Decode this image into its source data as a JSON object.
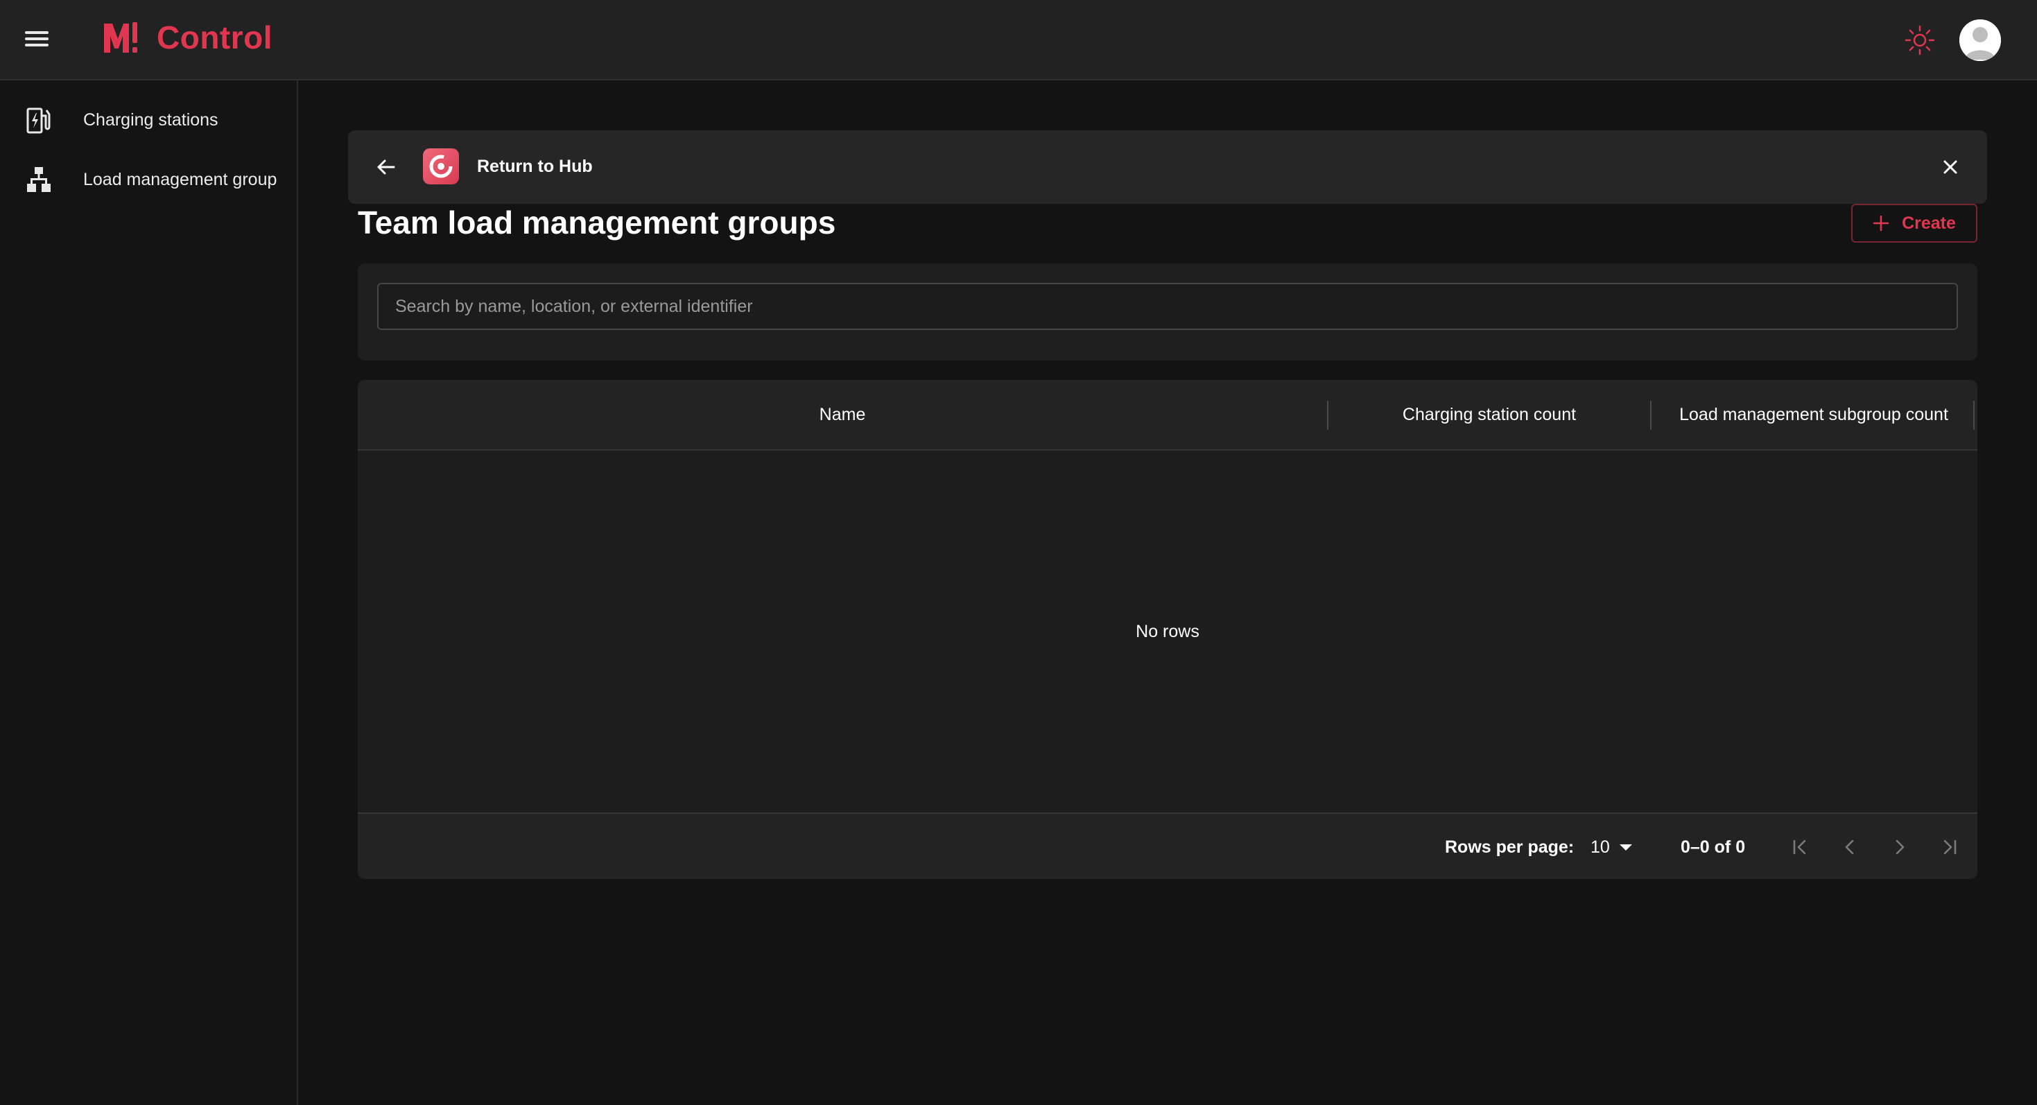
{
  "app": {
    "brand_mark": "M!",
    "brand_name": "Control",
    "accent_color": "#e0364f"
  },
  "topbar": {
    "menu_icon": "hamburger-menu-icon",
    "theme_icon": "sun-icon",
    "avatar_icon": "user-avatar-icon"
  },
  "sidebar": {
    "items": [
      {
        "label": "Charging stations",
        "icon": "charging-station-icon"
      },
      {
        "label": "Load management group",
        "icon": "hierarchy-icon"
      }
    ]
  },
  "hub_bar": {
    "back_icon": "arrow-left-icon",
    "app_icon": "hub-app-icon",
    "label": "Return to Hub",
    "close_icon": "close-icon"
  },
  "page": {
    "title": "Team load management groups",
    "create_label": "Create"
  },
  "search": {
    "placeholder": "Search by name, location, or external identifier",
    "value": ""
  },
  "table": {
    "columns": [
      "Name",
      "Charging station count",
      "Load management subgroup count"
    ],
    "rows": [],
    "empty_text": "No rows"
  },
  "pagination": {
    "rows_per_page_label": "Rows per page:",
    "rows_per_page_value": "10",
    "range_text": "0–0 of 0"
  }
}
